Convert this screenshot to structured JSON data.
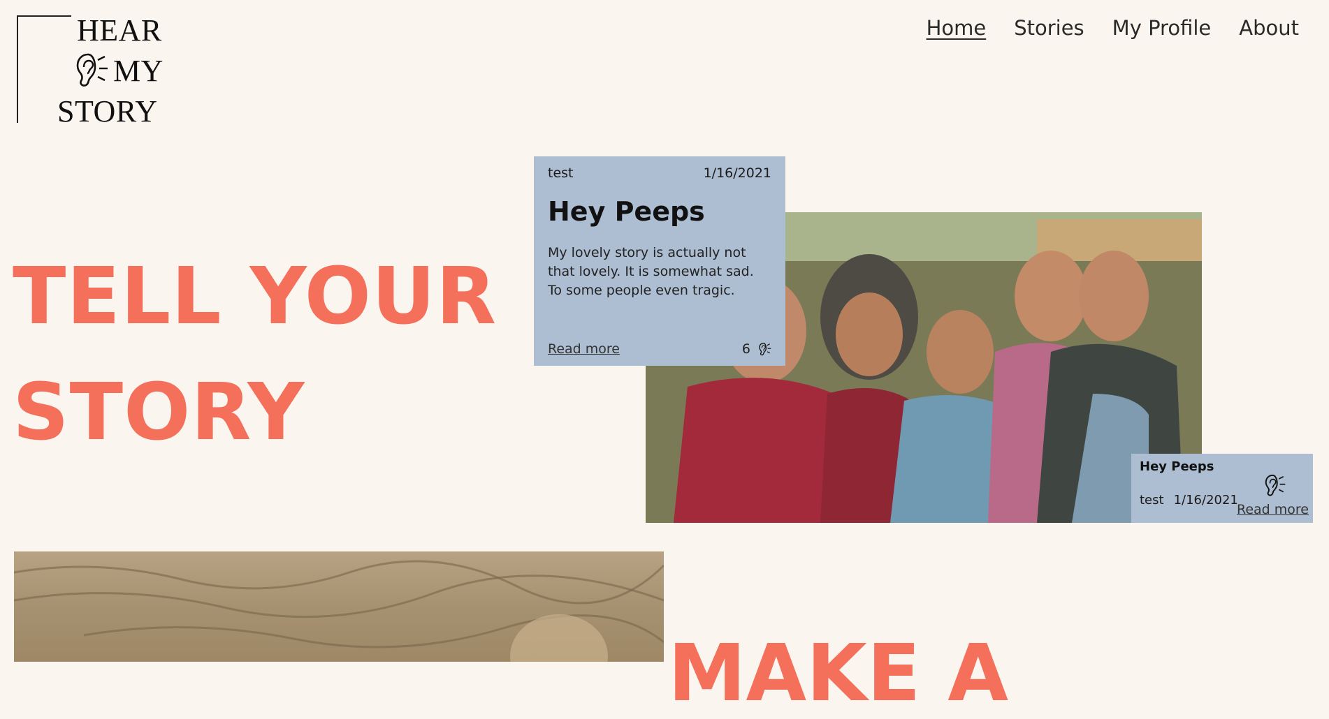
{
  "logo": {
    "line1": "HEAR",
    "line2": "MY",
    "line3": "STORY"
  },
  "nav": {
    "items": [
      {
        "label": "Home",
        "active": true
      },
      {
        "label": "Stories",
        "active": false
      },
      {
        "label": "My Profile",
        "active": false
      },
      {
        "label": "About",
        "active": false
      }
    ]
  },
  "hero": {
    "line1": "TELL YOUR",
    "line2": "STORY"
  },
  "card": {
    "author": "test",
    "date": "1/16/2021",
    "title": "Hey Peeps",
    "body": "My lovely story is actually not that lovely. It is somewhat sad. To some people even tragic.",
    "read_more": "Read more",
    "listen_count": "6"
  },
  "mini_card": {
    "title": "Hey Peeps",
    "author": "test",
    "date": "1/16/2021",
    "read_more": "Read more"
  },
  "section2": {
    "heading": "MAKE A"
  },
  "colors": {
    "accent": "#f5705a",
    "card": "#adbdd2",
    "background": "#faf5ef"
  },
  "icons": {
    "ear": "ear-icon"
  }
}
